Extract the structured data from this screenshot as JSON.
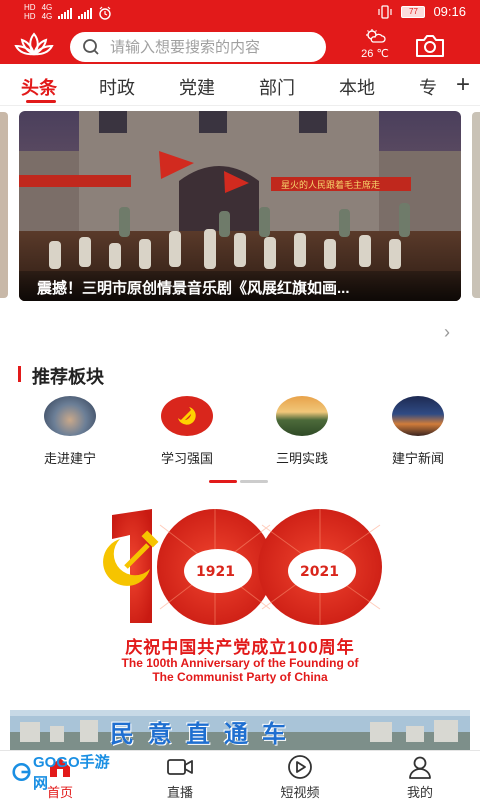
{
  "status_bar": {
    "carrier_tags": [
      "HD",
      "HD"
    ],
    "network": [
      "4G",
      "4G"
    ],
    "battery": "77",
    "time": "09:16"
  },
  "header": {
    "search_placeholder": "请输入想要搜索的内容",
    "weather_temp": "26 ℃",
    "icons": [
      "lotus-logo-icon",
      "search-icon",
      "weather-icon",
      "camera-icon"
    ]
  },
  "tabs": [
    "头条",
    "时政",
    "党建",
    "部门",
    "本地",
    "专"
  ],
  "active_tab": "头条",
  "banner": {
    "caption": "震撼！三明市原创情景音乐剧《风展红旗如画...",
    "banner_slogan": "星火的人民跟着毛主席走"
  },
  "recommend": {
    "title": "推荐板块",
    "items": [
      {
        "label": "走进建宁",
        "icon": "city-aerial-icon"
      },
      {
        "label": "学习强国",
        "icon": "party-emblem-icon"
      },
      {
        "label": "三明实践",
        "icon": "landscape-icon"
      },
      {
        "label": "建宁新闻",
        "icon": "city-night-icon"
      }
    ]
  },
  "poster": {
    "year_start": "1921",
    "year_end": "2021",
    "title": "庆祝中国共产党成立100周年",
    "english_line1": "The 100th Anniversary of the Founding of",
    "english_line2": "The Communist Party of China"
  },
  "strip": {
    "text": "民意直通车"
  },
  "bottom_nav": [
    {
      "label": "首页",
      "icon": "home-icon",
      "active": true
    },
    {
      "label": "直播",
      "icon": "video-camera-icon",
      "active": false
    },
    {
      "label": "短视频",
      "icon": "play-circle-icon",
      "active": false
    },
    {
      "label": "我的",
      "icon": "user-icon",
      "active": false
    }
  ],
  "watermark": "GOGO手游网",
  "colors": {
    "brand_red": "#e21a1a",
    "strip_blue": "#1f6fd0"
  }
}
